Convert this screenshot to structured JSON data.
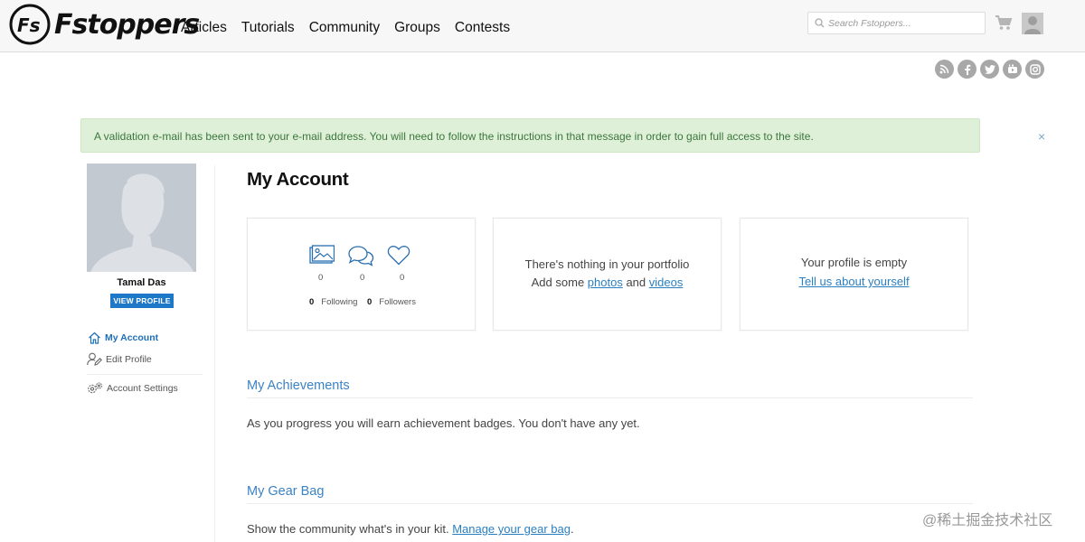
{
  "header": {
    "brand": "Fstoppers",
    "nav": [
      "Articles",
      "Tutorials",
      "Community",
      "Groups",
      "Contests"
    ],
    "search_placeholder": "Search Fstoppers..."
  },
  "socials": [
    "rss-icon",
    "facebook-icon",
    "twitter-icon",
    "youtube-icon",
    "instagram-icon"
  ],
  "alert": {
    "text": "A validation e-mail has been sent to your e-mail address. You will need to follow the instructions in that message in order to gain full access to the site.",
    "close": "×"
  },
  "sidebar": {
    "name": "Tamal Das",
    "view_profile": "VIEW PROFILE",
    "links": [
      {
        "label": "My Account",
        "icon": "home-icon",
        "active": true
      },
      {
        "label": "Edit Profile",
        "icon": "user-edit-icon",
        "active": false
      },
      {
        "label": "Account Settings",
        "icon": "gears-icon",
        "active": false
      }
    ]
  },
  "main": {
    "title": "My Account",
    "stats": {
      "photos": "0",
      "comments": "0",
      "likes": "0",
      "following_count": "0",
      "following_label": "Following",
      "followers_count": "0",
      "followers_label": "Followers"
    },
    "portfolio": {
      "line1": "There's nothing in your portfolio",
      "line2_prefix": "Add some ",
      "photos_link": "photos",
      "and": " and ",
      "videos_link": "videos"
    },
    "profile": {
      "line1": "Your profile is empty",
      "link": "Tell us about yourself"
    },
    "achievements": {
      "title": "My Achievements",
      "text": "As you progress you will earn achievement badges. You don't have any yet."
    },
    "gear_bag": {
      "title": "My Gear Bag",
      "text_prefix": "Show the community what's in your kit. ",
      "link": "Manage your gear bag",
      "text_suffix": "."
    }
  },
  "watermark": "@稀土掘金技术社区",
  "colors": {
    "accent": "#1e78c8",
    "alert_bg": "#dff0d8",
    "alert_text": "#3c763d",
    "section_title": "#3b82c4"
  }
}
